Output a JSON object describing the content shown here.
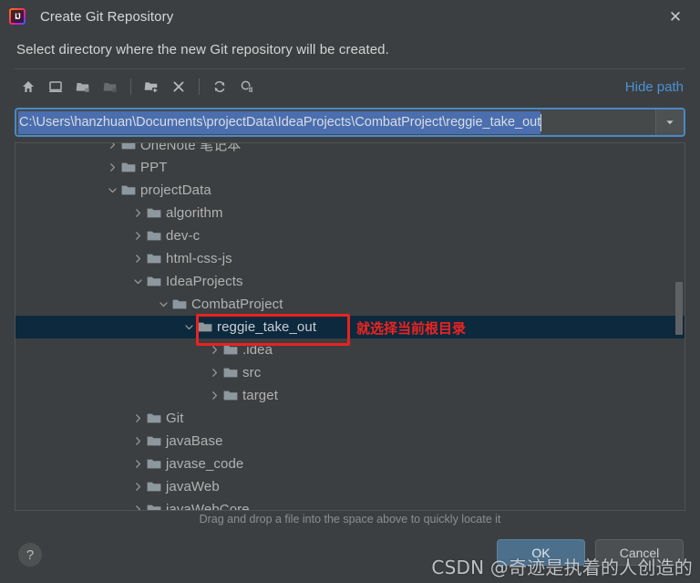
{
  "window": {
    "title": "Create Git Repository",
    "app_icon": "intellij-idea-icon",
    "close_label": "✕"
  },
  "prompt": "Select directory where the new Git repository will be created.",
  "toolbar": {
    "hide_path_label": "Hide path",
    "buttons": [
      {
        "name": "home-icon",
        "title": "Home",
        "disabled": false
      },
      {
        "name": "desktop-icon",
        "title": "Desktop",
        "disabled": false
      },
      {
        "name": "project-folder-icon",
        "title": "Project Directory",
        "disabled": false
      },
      {
        "name": "module-folder-icon",
        "title": "Module Directory",
        "disabled": true
      },
      {
        "name": "new-folder-icon",
        "title": "New Folder",
        "disabled": false
      },
      {
        "name": "delete-icon",
        "title": "Delete",
        "disabled": false
      },
      {
        "name": "refresh-icon",
        "title": "Refresh",
        "disabled": false
      },
      {
        "name": "show-hidden-files-icon",
        "title": "Show Hidden Files",
        "disabled": false
      }
    ]
  },
  "path_field": {
    "value": "C:\\Users\\hanzhuan\\Documents\\projectData\\IdeaProjects\\CombatProject\\reggie_take_out",
    "selected": true,
    "dropdown_icon": "chevron-down-icon"
  },
  "tree": {
    "rows": [
      {
        "label": "OneNote 笔记本",
        "depth": 1,
        "state": "collapsed",
        "selected": false
      },
      {
        "label": "PPT",
        "depth": 1,
        "state": "collapsed",
        "selected": false
      },
      {
        "label": "projectData",
        "depth": 1,
        "state": "expanded",
        "selected": false
      },
      {
        "label": "algorithm",
        "depth": 2,
        "state": "collapsed",
        "selected": false
      },
      {
        "label": "dev-c",
        "depth": 2,
        "state": "collapsed",
        "selected": false
      },
      {
        "label": "html-css-js",
        "depth": 2,
        "state": "collapsed",
        "selected": false
      },
      {
        "label": "IdeaProjects",
        "depth": 2,
        "state": "expanded",
        "selected": false
      },
      {
        "label": "CombatProject",
        "depth": 3,
        "state": "expanded",
        "selected": false
      },
      {
        "label": "reggie_take_out",
        "depth": 4,
        "state": "expanded",
        "selected": true
      },
      {
        "label": ".idea",
        "depth": 5,
        "state": "collapsed",
        "selected": false
      },
      {
        "label": "src",
        "depth": 5,
        "state": "collapsed",
        "selected": false
      },
      {
        "label": "target",
        "depth": 5,
        "state": "collapsed",
        "selected": false
      },
      {
        "label": "Git",
        "depth": 2,
        "state": "collapsed",
        "selected": false
      },
      {
        "label": "javaBase",
        "depth": 2,
        "state": "collapsed",
        "selected": false
      },
      {
        "label": "javase_code",
        "depth": 2,
        "state": "collapsed",
        "selected": false
      },
      {
        "label": "javaWeb",
        "depth": 2,
        "state": "collapsed",
        "selected": false
      },
      {
        "label": "javaWebCore",
        "depth": 2,
        "state": "collapsed",
        "selected": false
      }
    ]
  },
  "annotation": {
    "note_text": "就选择当前根目录",
    "color": "#ee2420"
  },
  "footer": {
    "drag_hint": "Drag and drop a file into the space above to quickly locate it",
    "help_label": "?",
    "ok_label": "OK",
    "cancel_label": "Cancel"
  },
  "watermark": "CSDN @奇迹是执着的人创造的",
  "colors": {
    "background": "#3c3f41",
    "selection": "#0d293e",
    "accent_link": "#4a92d6",
    "field_border": "#4a88c7",
    "text_selection": "#4b6eaf",
    "annotation_red": "#e8231f",
    "ok_button": "#4c708c"
  }
}
